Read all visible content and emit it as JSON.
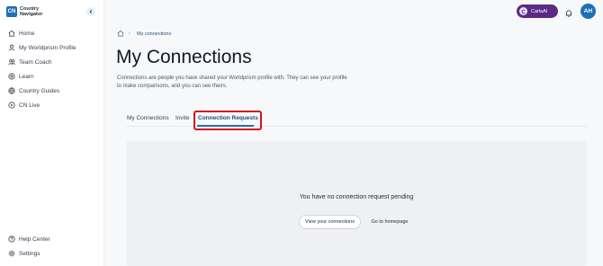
{
  "brand": {
    "mark": "CN",
    "line1": "Country",
    "line2": "Navigator"
  },
  "sidebar": {
    "items": [
      {
        "label": "Home",
        "icon": "home-icon"
      },
      {
        "label": "My Worldprism Profile",
        "icon": "user-icon"
      },
      {
        "label": "Team Coach",
        "icon": "team-icon"
      },
      {
        "label": "Learn",
        "icon": "learn-icon"
      },
      {
        "label": "Country Guides",
        "icon": "globe-icon"
      },
      {
        "label": "CN Live",
        "icon": "live-icon"
      }
    ],
    "bottom": [
      {
        "label": "Help Center",
        "icon": "help-icon"
      },
      {
        "label": "Settings",
        "icon": "gear-icon"
      }
    ]
  },
  "topbar": {
    "assistant_label": "CarlaAI",
    "avatar_initials": "AH"
  },
  "breadcrumb": {
    "current": "My connections"
  },
  "page": {
    "title": "My Connections",
    "description": "Connections are people you have shared your Worldprism profile with. They can see your profile to make comparisons, and you can see theirs."
  },
  "tabs": [
    {
      "label": "My Connections"
    },
    {
      "label": "Invite"
    },
    {
      "label": "Connection Requests",
      "active": true
    }
  ],
  "empty_state": {
    "message": "You have no connection request pending",
    "primary_button": "View your connections",
    "secondary_button": "Go to homepage"
  },
  "colors": {
    "accent": "#1f6fb5",
    "assistant": "#5b2a86",
    "highlight": "#d0141d"
  }
}
